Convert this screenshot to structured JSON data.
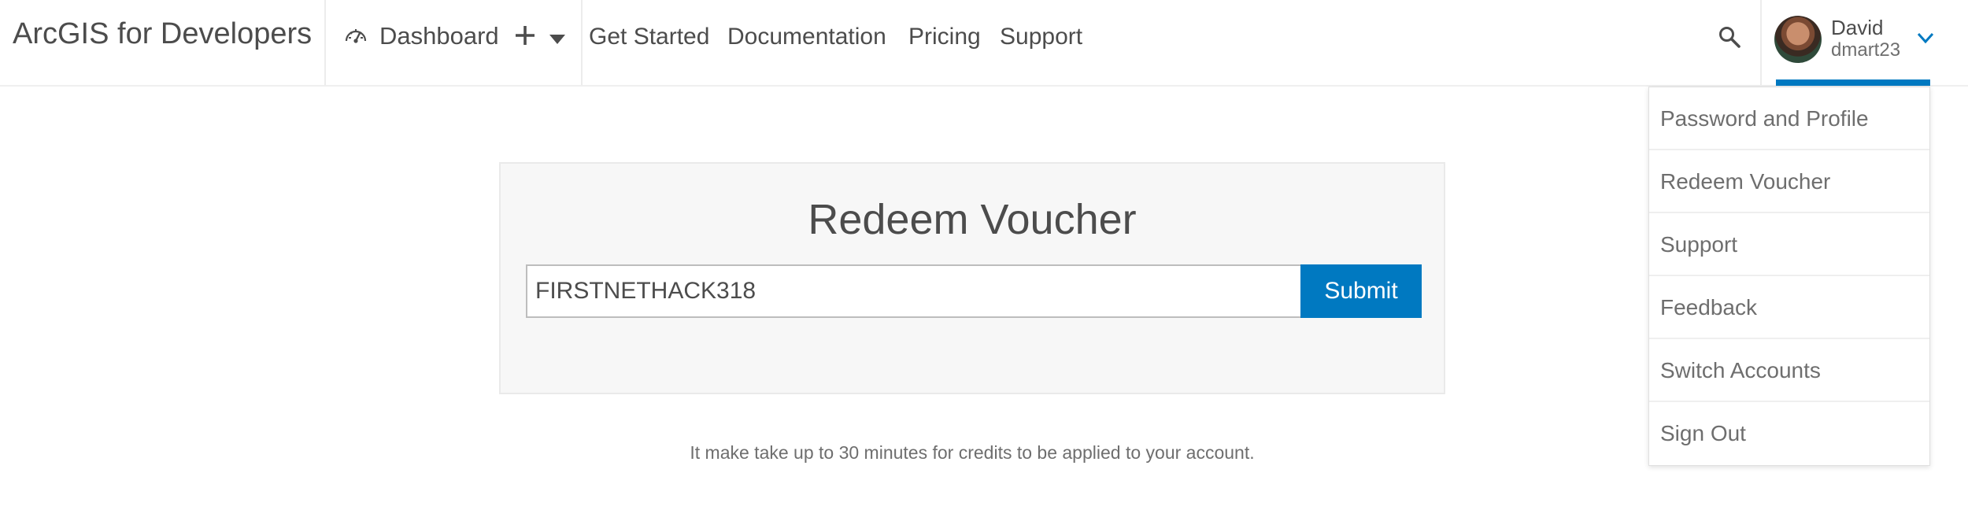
{
  "header": {
    "brand": "ArcGIS for Developers",
    "dashboard_label": "Dashboard",
    "nav_links": [
      "Get Started",
      "Documentation",
      "Pricing",
      "Support"
    ],
    "icons": {
      "dashboard": "speedometer-icon",
      "add": "plus-icon",
      "add_menu": "caret-down-icon",
      "search": "search-icon",
      "user_menu": "chevron-down-icon"
    },
    "user": {
      "name": "David",
      "username": "dmart23"
    }
  },
  "user_dropdown": {
    "items": [
      "Password and Profile",
      "Redeem Voucher",
      "Support",
      "Feedback",
      "Switch Accounts",
      "Sign Out"
    ]
  },
  "voucher": {
    "title": "Redeem Voucher",
    "input_value": "FIRSTNETHACK318",
    "submit_label": "Submit",
    "note": "It make take up to 30 minutes for credits to be applied to your account."
  },
  "colors": {
    "accent": "#0079c1",
    "text": "#4c4c4c",
    "panel_bg": "#f7f7f7"
  }
}
